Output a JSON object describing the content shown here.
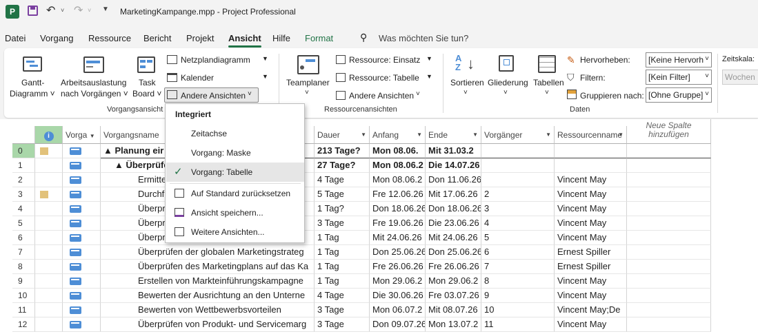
{
  "window": {
    "title": "MarketingKampange.mpp - Project Professional",
    "app_icon": "P"
  },
  "menu": [
    "Datei",
    "Vorgang",
    "Ressource",
    "Bericht",
    "Projekt",
    "Ansicht",
    "Hilfe",
    "Format"
  ],
  "active_menu": "Ansicht",
  "search": {
    "placeholder": "Was möchten Sie tun?"
  },
  "ribbon": {
    "gantt_line1": "Gantt-",
    "gantt_line2": "Diagramm ˅",
    "auslastung_line1": "Arbeitsauslastung",
    "auslastung_line2": "nach Vorgängen ˅",
    "taskboard_line1": "Task",
    "taskboard_line2": "Board ˅",
    "netzplan": "Netzplandiagramm",
    "kalender": "Kalender",
    "andere": "Andere Ansichten",
    "group_vorgang": "Vorgangsansicht",
    "teamplaner": "Teamplaner",
    "res_einsatz": "Ressource: Einsatz",
    "res_tabelle": "Ressource: Tabelle",
    "res_andere": "Andere Ansichten",
    "group_ressource": "Ressourcenansichten",
    "sortieren": "Sortieren",
    "gliederung": "Gliederung",
    "tabellen": "Tabellen",
    "hervorheben": "Hervorheben:",
    "filtern": "Filtern:",
    "gruppieren": "Gruppieren nach:",
    "hervorheben_val": "[Keine Hervorh",
    "filter_val": "[Kein Filter]",
    "gruppe_val": "[Ohne Gruppe]",
    "group_daten": "Daten",
    "zeitskala": "Zeitskala:",
    "zeitskala_val": "Wochen"
  },
  "popup": {
    "header": "Integriert",
    "items": [
      "Zeitachse",
      "Vorgang: Maske",
      "Vorgang: Tabelle",
      "Auf Standard zurücksetzen",
      "Ansicht speichern...",
      "Weitere Ansichten..."
    ],
    "checked": "Vorgang: Tabelle"
  },
  "columns": {
    "mode": "Vorga",
    "name": "Vorgangsname",
    "dauer": "Dauer",
    "anfang": "Anfang",
    "ende": "Ende",
    "vorg": "Vorgänger",
    "res": "Ressourcenname",
    "new1": "Neue Spalte",
    "new2": "hinzufügen"
  },
  "rows": [
    {
      "id": "0",
      "name": "▲ Planung eir",
      "dauer": "213 Tage?",
      "anfang": "Mon 08.06.",
      "ende": "Mit 31.03.2",
      "vorg": "",
      "res": "",
      "bold": true,
      "indent": 0,
      "note": true
    },
    {
      "id": "1",
      "name": "▲ Überprüfe",
      "dauer": "27 Tage?",
      "anfang": "Mon 08.06.2",
      "ende": "Die 14.07.26",
      "vorg": "",
      "res": "",
      "bold": true,
      "indent": 1,
      "note": false
    },
    {
      "id": "2",
      "name": "Ermitte",
      "dauer": "4 Tage",
      "anfang": "Mon 08.06.2",
      "ende": "Don 11.06.26",
      "vorg": "",
      "res": "Vincent May",
      "bold": false,
      "indent": 2,
      "note": false
    },
    {
      "id": "3",
      "name": "Durchf",
      "dauer": "5 Tage",
      "anfang": "Fre 12.06.26",
      "ende": "Mit 17.06.26",
      "vorg": "2",
      "res": "Vincent May",
      "bold": false,
      "indent": 2,
      "note": true
    },
    {
      "id": "4",
      "name": "Überpr",
      "dauer": "1 Tag?",
      "anfang": "Don 18.06.26",
      "ende": "Don 18.06.26",
      "vorg": "3",
      "res": "Vincent May",
      "bold": false,
      "indent": 2,
      "note": false
    },
    {
      "id": "5",
      "name": "Überpr",
      "dauer": "3 Tage",
      "anfang": "Fre 19.06.26",
      "ende": "Die 23.06.26",
      "vorg": "4",
      "res": "Vincent May",
      "bold": false,
      "indent": 2,
      "note": false
    },
    {
      "id": "6",
      "name": "Überpr",
      "dauer": "1 Tag",
      "anfang": "Mit 24.06.26",
      "ende": "Mit 24.06.26",
      "vorg": "5",
      "res": "Vincent May",
      "bold": false,
      "indent": 2,
      "note": false
    },
    {
      "id": "7",
      "name": "Überprüfen der globalen Marketingstrateg",
      "dauer": "1 Tag",
      "anfang": "Don 25.06.26",
      "ende": "Don 25.06.26",
      "vorg": "6",
      "res": "Ernest Spiller",
      "bold": false,
      "indent": 2,
      "note": false
    },
    {
      "id": "8",
      "name": "Überprüfen des Marketingplans auf das Ka",
      "dauer": "1 Tag",
      "anfang": "Fre 26.06.26",
      "ende": "Fre 26.06.26",
      "vorg": "7",
      "res": "Ernest Spiller",
      "bold": false,
      "indent": 2,
      "note": false
    },
    {
      "id": "9",
      "name": "Erstellen von Markteinführungskampagne",
      "dauer": "1 Tag",
      "anfang": "Mon 29.06.2",
      "ende": "Mon 29.06.2",
      "vorg": "8",
      "res": "Vincent May",
      "bold": false,
      "indent": 2,
      "note": false
    },
    {
      "id": "10",
      "name": "Bewerten der Ausrichtung an den Unterne",
      "dauer": "4 Tage",
      "anfang": "Die 30.06.26",
      "ende": "Fre 03.07.26",
      "vorg": "9",
      "res": "Vincent May",
      "bold": false,
      "indent": 2,
      "note": false
    },
    {
      "id": "11",
      "name": "Bewerten von Wettbewerbsvorteilen",
      "dauer": "3 Tage",
      "anfang": "Mon 06.07.2",
      "ende": "Mit 08.07.26",
      "vorg": "10",
      "res": "Vincent May;De",
      "bold": false,
      "indent": 2,
      "note": false
    },
    {
      "id": "12",
      "name": "Überprüfen von Produkt- und Servicemarg",
      "dauer": "3 Tage",
      "anfang": "Don 09.07.26",
      "ende": "Mon 13.07.2",
      "vorg": "11",
      "res": "Vincent May",
      "bold": false,
      "indent": 2,
      "note": false
    }
  ],
  "colors": {
    "accent": "#217346",
    "selected_row": "#a9d7a9",
    "task_icon": "#4e8ed6",
    "note": "#e2c27b"
  }
}
